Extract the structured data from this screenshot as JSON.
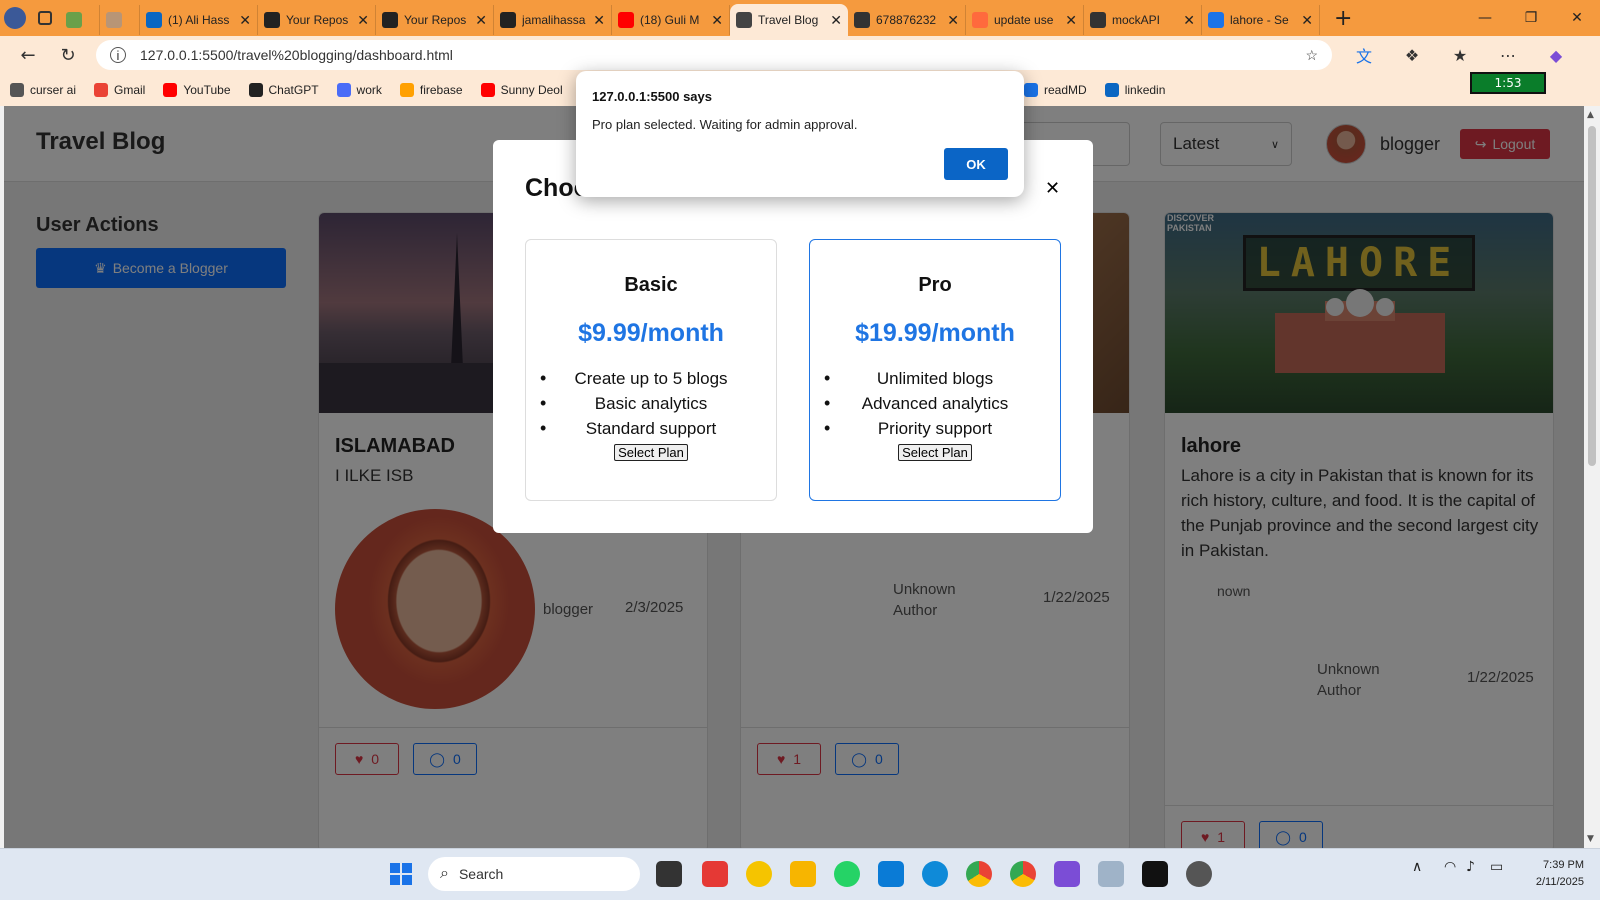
{
  "browser": {
    "tabs": [
      {
        "title": "",
        "active": false,
        "favicon_color": "#6aa04a"
      },
      {
        "title": "",
        "active": false,
        "favicon_color": "#b89576"
      },
      {
        "title": "(1) Ali Hass",
        "active": false,
        "favicon_color": "#0a66c2"
      },
      {
        "title": "Your Repos",
        "active": false,
        "favicon_color": "#222222"
      },
      {
        "title": "Your Repos",
        "active": false,
        "favicon_color": "#222222"
      },
      {
        "title": "jamalihassa",
        "active": false,
        "favicon_color": "#222222"
      },
      {
        "title": "(18) Guli M",
        "active": false,
        "favicon_color": "#ff0000"
      },
      {
        "title": "Travel Blog",
        "active": true,
        "favicon_color": "#444444"
      },
      {
        "title": "678876232",
        "active": false,
        "favicon_color": "#333333"
      },
      {
        "title": "update use",
        "active": false,
        "favicon_color": "#ff6a3d"
      },
      {
        "title": "mockAPI",
        "active": false,
        "favicon_color": "#333333"
      },
      {
        "title": "lahore - Se",
        "active": false,
        "favicon_color": "#1a73e8"
      }
    ],
    "url": "127.0.0.1:5500/travel%20blogging/dashboard.html",
    "bookmarks": [
      {
        "label": "curser ai",
        "color": "#555555"
      },
      {
        "label": "Gmail",
        "color": "#ea4335"
      },
      {
        "label": "YouTube",
        "color": "#ff0000"
      },
      {
        "label": "ChatGPT",
        "color": "#222222"
      },
      {
        "label": "work",
        "color": "#4a6cf7"
      },
      {
        "label": "firebase",
        "color": "#ffa000"
      },
      {
        "label": "Sunny Deol",
        "color": "#ff0000"
      }
    ],
    "bookmarks_right": [
      {
        "label": "readMD",
        "color": "#1a73e8"
      },
      {
        "label": "linkedin",
        "color": "#0a66c2"
      }
    ],
    "timer": "1:53"
  },
  "page": {
    "site_title": "Travel Blog",
    "sort_value": "Latest",
    "username": "blogger",
    "logout_label": "Logout",
    "sidebar_title": "User Actions",
    "become_label": "Become a Blogger"
  },
  "cards": [
    {
      "title": "ISLAMABAD",
      "text": "I ILKE ISB",
      "author": "blogger",
      "date": "2/3/2025",
      "likes": "0",
      "comments": "0"
    },
    {
      "title": "",
      "text": "",
      "author": "Unknown Author",
      "date": "1/22/2025",
      "likes": "1",
      "comments": "0"
    },
    {
      "title": "lahore",
      "text": "Lahore is a city in Pakistan that is known for its rich history, culture, and food. It is the capital of the Punjab province and the second largest city in Pakistan.",
      "broken_img_alt": "nown",
      "author": "Unknown Author",
      "date": "1/22/2025",
      "likes": "1",
      "comments": "0",
      "image_banner": "LAHORE",
      "image_caption": "DISCOVER PAKISTAN"
    }
  ],
  "modal": {
    "title": "Choose Your Plan",
    "plans": [
      {
        "name": "Basic",
        "price": "$9.99/month",
        "features": [
          "Create up to 5 blogs",
          "Basic analytics",
          "Standard support"
        ],
        "button": "Select Plan",
        "selected": false
      },
      {
        "name": "Pro",
        "price": "$19.99/month",
        "features": [
          "Unlimited blogs",
          "Advanced analytics",
          "Priority support"
        ],
        "button": "Select Plan",
        "selected": true
      }
    ]
  },
  "alert": {
    "origin": "127.0.0.1:5500 says",
    "message": "Pro plan selected. Waiting for admin approval.",
    "ok_label": "OK"
  },
  "taskbar": {
    "search_placeholder": "Search",
    "time": "7:39 PM",
    "date": "2/11/2025"
  }
}
